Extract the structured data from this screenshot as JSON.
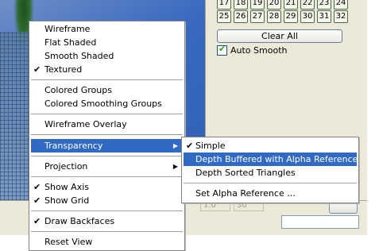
{
  "number_grid": {
    "row1": [
      "17",
      "18",
      "19",
      "20",
      "21",
      "22",
      "23",
      "24"
    ],
    "row2": [
      "25",
      "26",
      "27",
      "28",
      "29",
      "30",
      "31",
      "32"
    ]
  },
  "clear_all_label": "Clear All",
  "auto_smooth": {
    "label": "Auto Smooth",
    "checked": true
  },
  "fields": {
    "left_value": "1.0",
    "right_value": "30"
  },
  "menu": {
    "items": [
      {
        "label": "Wireframe",
        "checked": false
      },
      {
        "label": "Flat Shaded",
        "checked": false
      },
      {
        "label": "Smooth Shaded",
        "checked": false
      },
      {
        "label": "Textured",
        "checked": true
      },
      {
        "label": "Colored Groups",
        "checked": false
      },
      {
        "label": "Colored Smoothing Groups",
        "checked": false
      },
      {
        "label": "Wireframe Overlay",
        "checked": false
      },
      {
        "label": "Transparency",
        "submenu": true,
        "highlighted": true
      },
      {
        "label": "Projection",
        "submenu": true
      },
      {
        "label": "Show Axis",
        "checked": true
      },
      {
        "label": "Show Grid",
        "checked": true
      },
      {
        "label": "Draw Backfaces",
        "checked": true
      },
      {
        "label": "Reset View",
        "checked": false
      }
    ]
  },
  "transparency_submenu": {
    "items": [
      {
        "label": "Simple",
        "checked": true
      },
      {
        "label": "Depth Buffered with Alpha Reference",
        "highlighted": true
      },
      {
        "label": "Depth Sorted Triangles"
      },
      {
        "label": "Set Alpha Reference ..."
      }
    ]
  },
  "glyphs": {
    "check": "✔",
    "submenu_arrow": "▶"
  },
  "colors": {
    "highlight": "#316ac5",
    "panel": "#ece9d8",
    "viewport_blue": "#2e5fb8"
  }
}
